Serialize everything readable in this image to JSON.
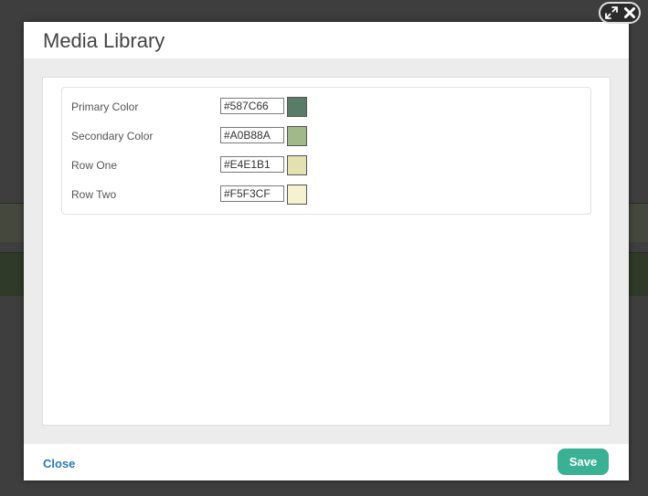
{
  "modal": {
    "title": "Media Library"
  },
  "colors": [
    {
      "label": "Primary Color",
      "value": "#587C66",
      "swatch": "#587C66"
    },
    {
      "label": "Secondary Color",
      "value": "#A0B88A",
      "swatch": "#A0B88A"
    },
    {
      "label": "Row One",
      "value": "#E4E1B1",
      "swatch": "#E4E1B1"
    },
    {
      "label": "Row Two",
      "value": "#F5F3CF",
      "swatch": "#F5F3CF"
    }
  ],
  "footer": {
    "close_label": "Close",
    "save_label": "Save"
  },
  "icons": {
    "expand": "expand-icon",
    "close": "close-icon"
  },
  "theme": {
    "save_button": "#3ab094",
    "link": "#2a7ab8"
  }
}
